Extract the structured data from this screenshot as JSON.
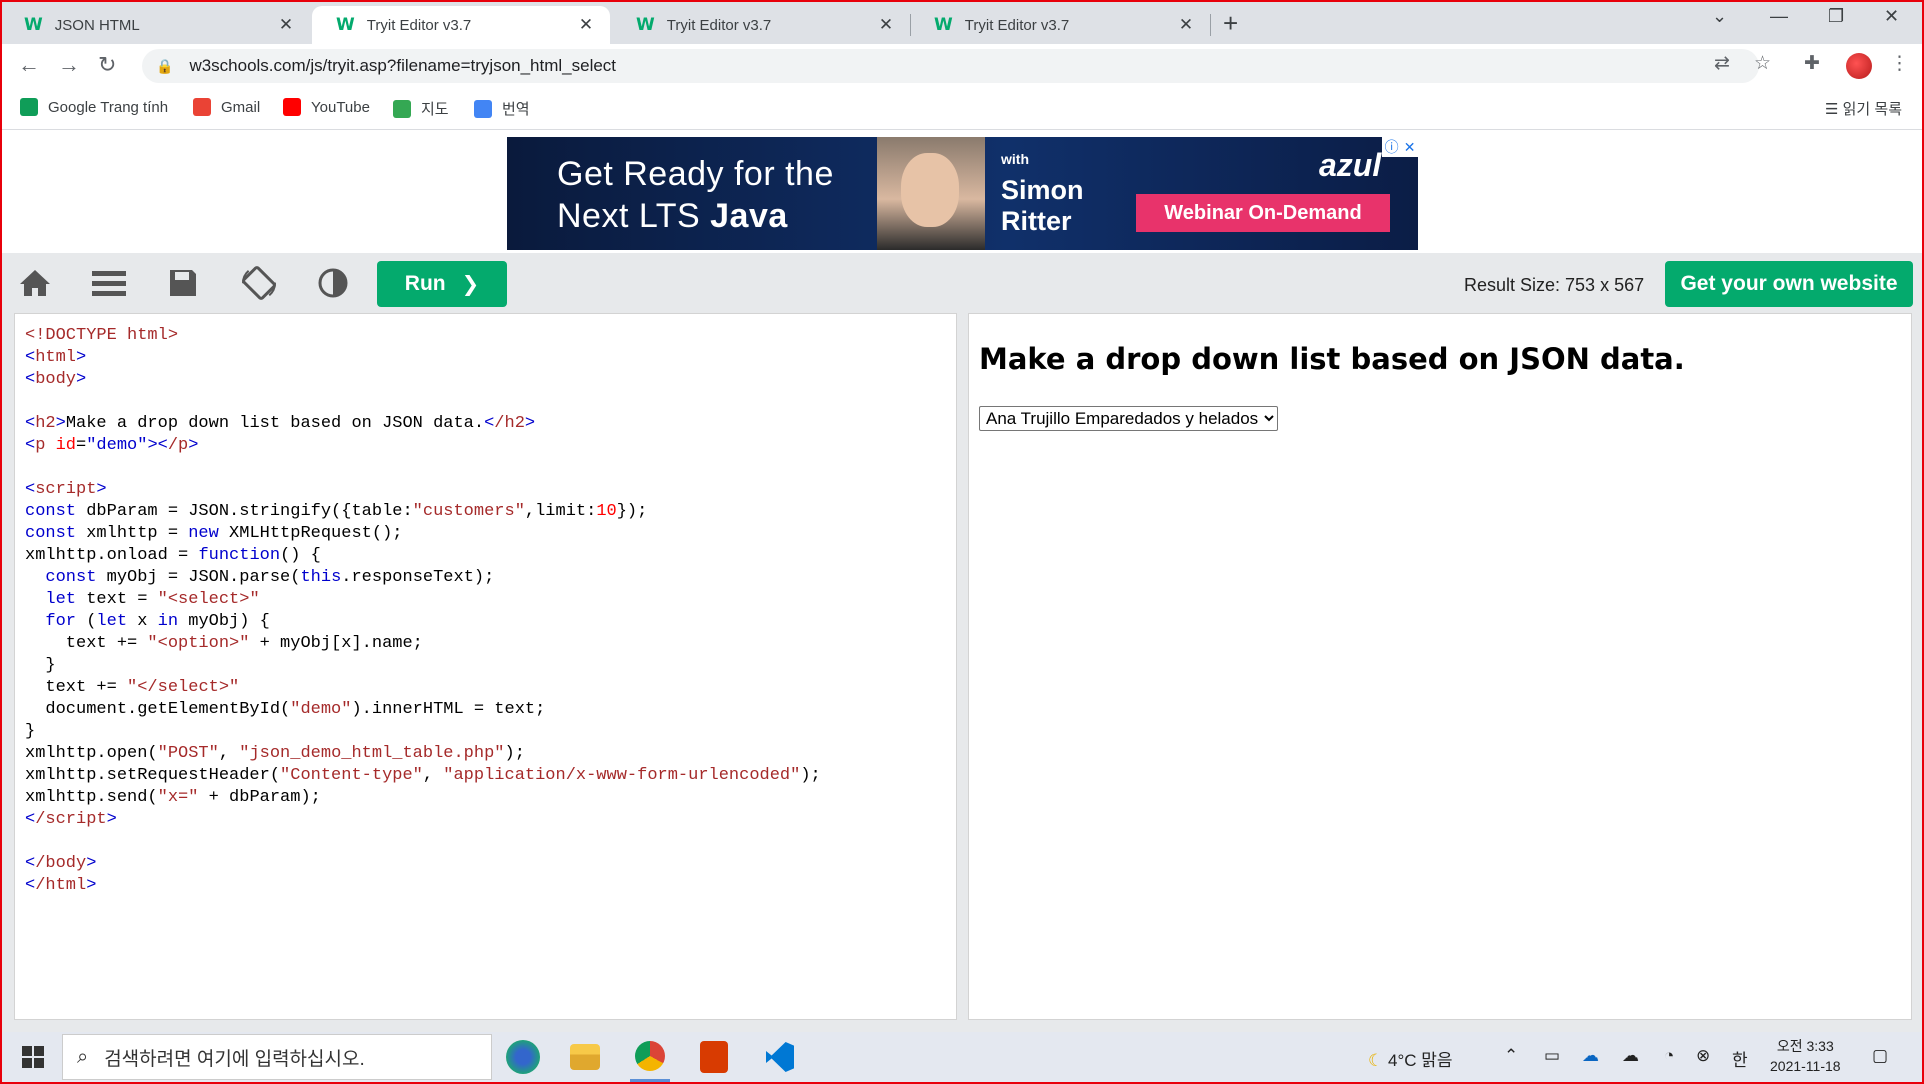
{
  "browser": {
    "tabs": [
      {
        "label": "JSON HTML",
        "active": false
      },
      {
        "label": "Tryit Editor v3.7",
        "active": true
      },
      {
        "label": "Tryit Editor v3.7",
        "active": false
      },
      {
        "label": "Tryit Editor v3.7",
        "active": false
      }
    ],
    "url": "w3schools.com/js/tryit.asp?filename=tryjson_html_select",
    "bookmarks": [
      {
        "label": "Google Trang tính",
        "color": "#0f9d58"
      },
      {
        "label": "Gmail",
        "color": "#ea4335"
      },
      {
        "label": "YouTube",
        "color": "#ff0000"
      },
      {
        "label": "지도",
        "color": "#34a853"
      },
      {
        "label": "번역",
        "color": "#4285f4"
      }
    ],
    "reading_list": "읽기 목록"
  },
  "ad": {
    "headline_1": "Get Ready for the",
    "headline_2a": "Next LTS ",
    "headline_2b": "Java",
    "with": "with",
    "name_1": "Simon",
    "name_2": "Ritter",
    "brand": "azul",
    "cta": "Webinar On-Demand"
  },
  "editor": {
    "run_label": "Run",
    "result_size": "Result Size: 753 x 567",
    "get_site_label": "Get your own website"
  },
  "result": {
    "heading": "Make a drop down list based on JSON data.",
    "selected_option": "Ana Trujillo Emparedados y helados"
  },
  "taskbar": {
    "search_placeholder": "검색하려면 여기에 입력하십시오.",
    "weather": "4°C 맑음",
    "ime": "한",
    "time": "오전 3:33",
    "date": "2021-11-18"
  },
  "colors": {
    "w3_green": "#04aa6d",
    "frame_red": "#e8000b",
    "ad_pink": "#e8336b"
  }
}
